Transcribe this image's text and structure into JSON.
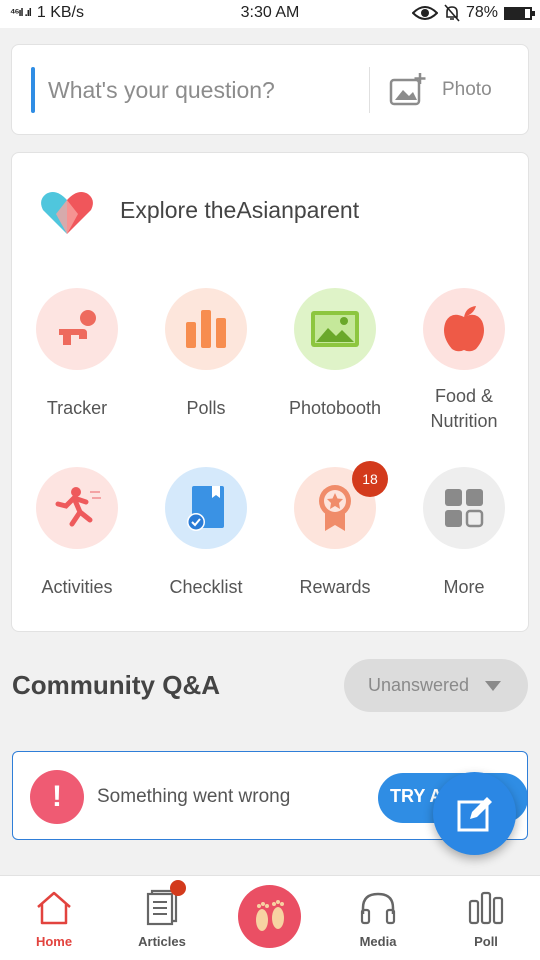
{
  "status_bar": {
    "signal": "⁴⁶ıl .ıl",
    "speed": "1 KB/s",
    "time": "3:30 AM",
    "battery": "78%",
    "battery_level": 0.78
  },
  "question_box": {
    "placeholder": "What's your question?",
    "photo_label": "Photo"
  },
  "explore": {
    "title": "Explore theAsianparent",
    "tiles": [
      {
        "label": "Tracker",
        "icon": "baby-crawling-icon"
      },
      {
        "label": "Polls",
        "icon": "poll-bars-icon"
      },
      {
        "label": "Photobooth",
        "icon": "image-icon"
      },
      {
        "label": "Food &\nNutrition",
        "icon": "apple-icon"
      },
      {
        "label": "Activities",
        "icon": "running-person-icon"
      },
      {
        "label": "Checklist",
        "icon": "checklist-book-icon"
      },
      {
        "label": "Rewards",
        "icon": "award-ribbon-icon",
        "badge": "18"
      },
      {
        "label": "More",
        "icon": "grid-more-icon"
      }
    ]
  },
  "community": {
    "title": "Community Q&A",
    "filter_value": "Unanswered"
  },
  "error_banner": {
    "icon_text": "!",
    "message": "Something went wrong",
    "retry_label": "TRY AGAIN"
  },
  "bottom_nav": {
    "items": [
      {
        "label": "Home",
        "icon": "home-icon",
        "active": true
      },
      {
        "label": "Articles",
        "icon": "articles-icon"
      },
      {
        "label": "",
        "icon": "footprints-icon"
      },
      {
        "label": "Media",
        "icon": "headphones-icon"
      },
      {
        "label": "Poll",
        "icon": "poll-icon"
      }
    ]
  },
  "colors": {
    "accent_blue": "#2f8de4",
    "active_red": "#e2433e",
    "badge_red": "#d33a1c",
    "error_pink": "#ef5b73"
  }
}
